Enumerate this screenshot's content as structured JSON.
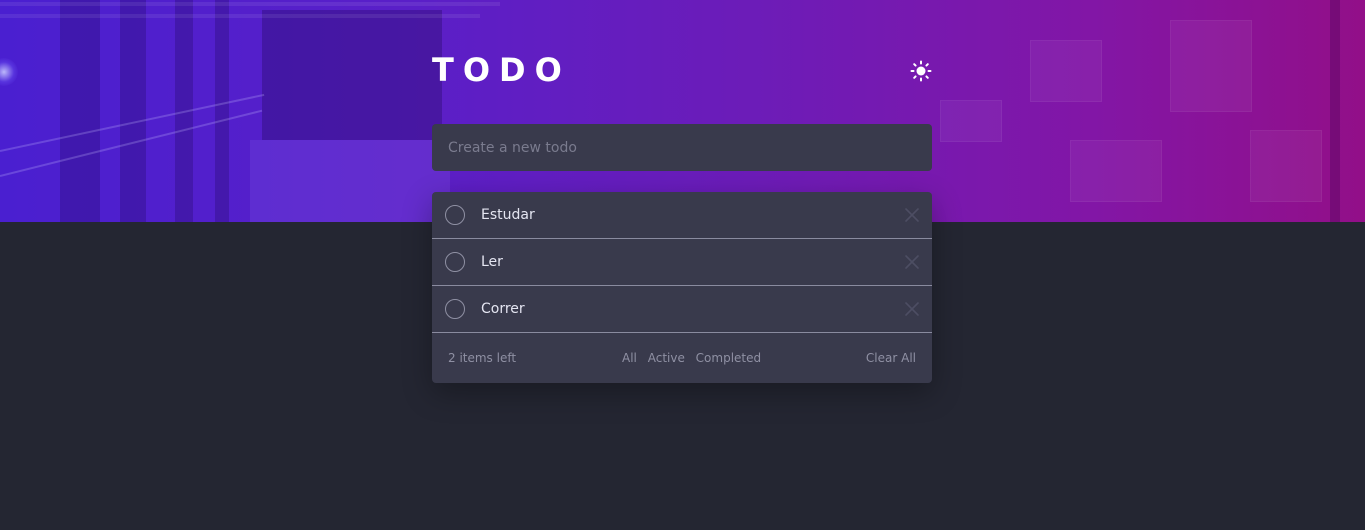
{
  "app": {
    "title": "TODO",
    "theme_toggle_icon": "sun-icon"
  },
  "input": {
    "placeholder": "Create a new todo",
    "value": ""
  },
  "todos": [
    {
      "label": "Estudar",
      "completed": false
    },
    {
      "label": "Ler",
      "completed": false
    },
    {
      "label": "Correr",
      "completed": false
    }
  ],
  "footer": {
    "items_left": "2 items left",
    "filters": [
      "All",
      "Active",
      "Completed"
    ],
    "clear": "Clear All"
  },
  "colors": {
    "background": "#242632",
    "card": "#393a4c",
    "text": "#e4e5f1",
    "muted": "#8f90a3",
    "hero_start": "#4a1fd0",
    "hero_end": "#920f88"
  }
}
